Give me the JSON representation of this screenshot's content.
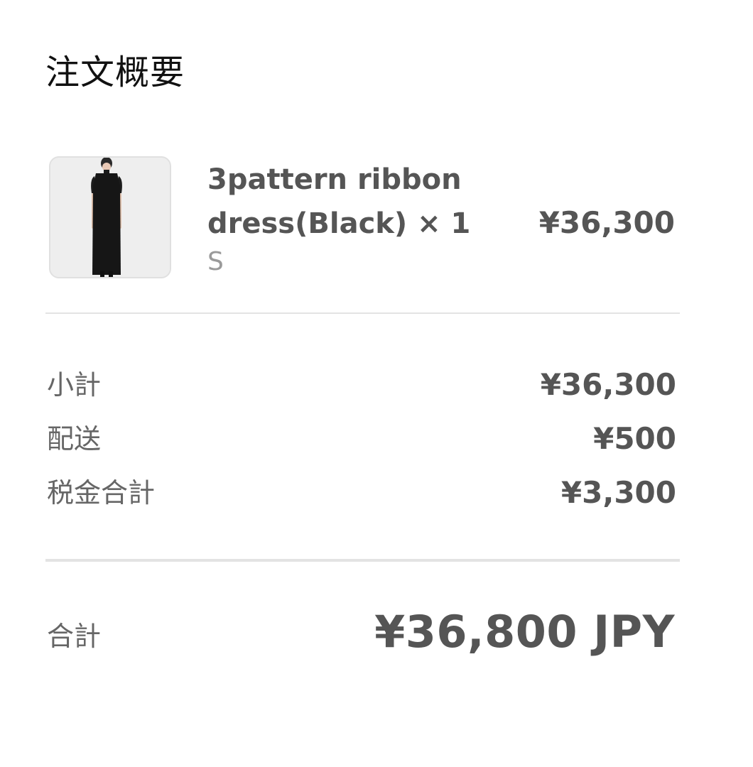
{
  "header": {
    "title": "注文概要"
  },
  "line_item": {
    "image_alt": "product-photo",
    "name_line1": "3pattern ribbon",
    "name_line2": "dress(Black) × 1",
    "variant": "S",
    "price": "¥36,300"
  },
  "summary": {
    "subtotal_label": "小計",
    "subtotal_value": "¥36,300",
    "shipping_label": "配送",
    "shipping_value": "¥500",
    "tax_label": "税金合計",
    "tax_value": "¥3,300"
  },
  "total": {
    "label": "合計",
    "value": "¥36,800 JPY"
  },
  "colors": {
    "title": "#111111",
    "text": "#555555",
    "muted": "#9a9a9a",
    "divider": "#e3e3e3"
  }
}
